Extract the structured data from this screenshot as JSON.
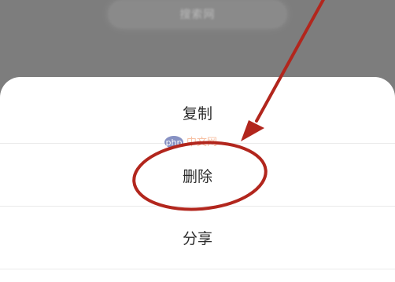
{
  "background_pill": {
    "label": "搜索网"
  },
  "action_sheet": {
    "items": [
      {
        "label": "复制"
      },
      {
        "label": "删除"
      },
      {
        "label": "分享"
      }
    ]
  },
  "watermark": {
    "brand_latin": "php",
    "brand_cjk": "中文网"
  },
  "annotation": {
    "color": "#b2261d"
  }
}
